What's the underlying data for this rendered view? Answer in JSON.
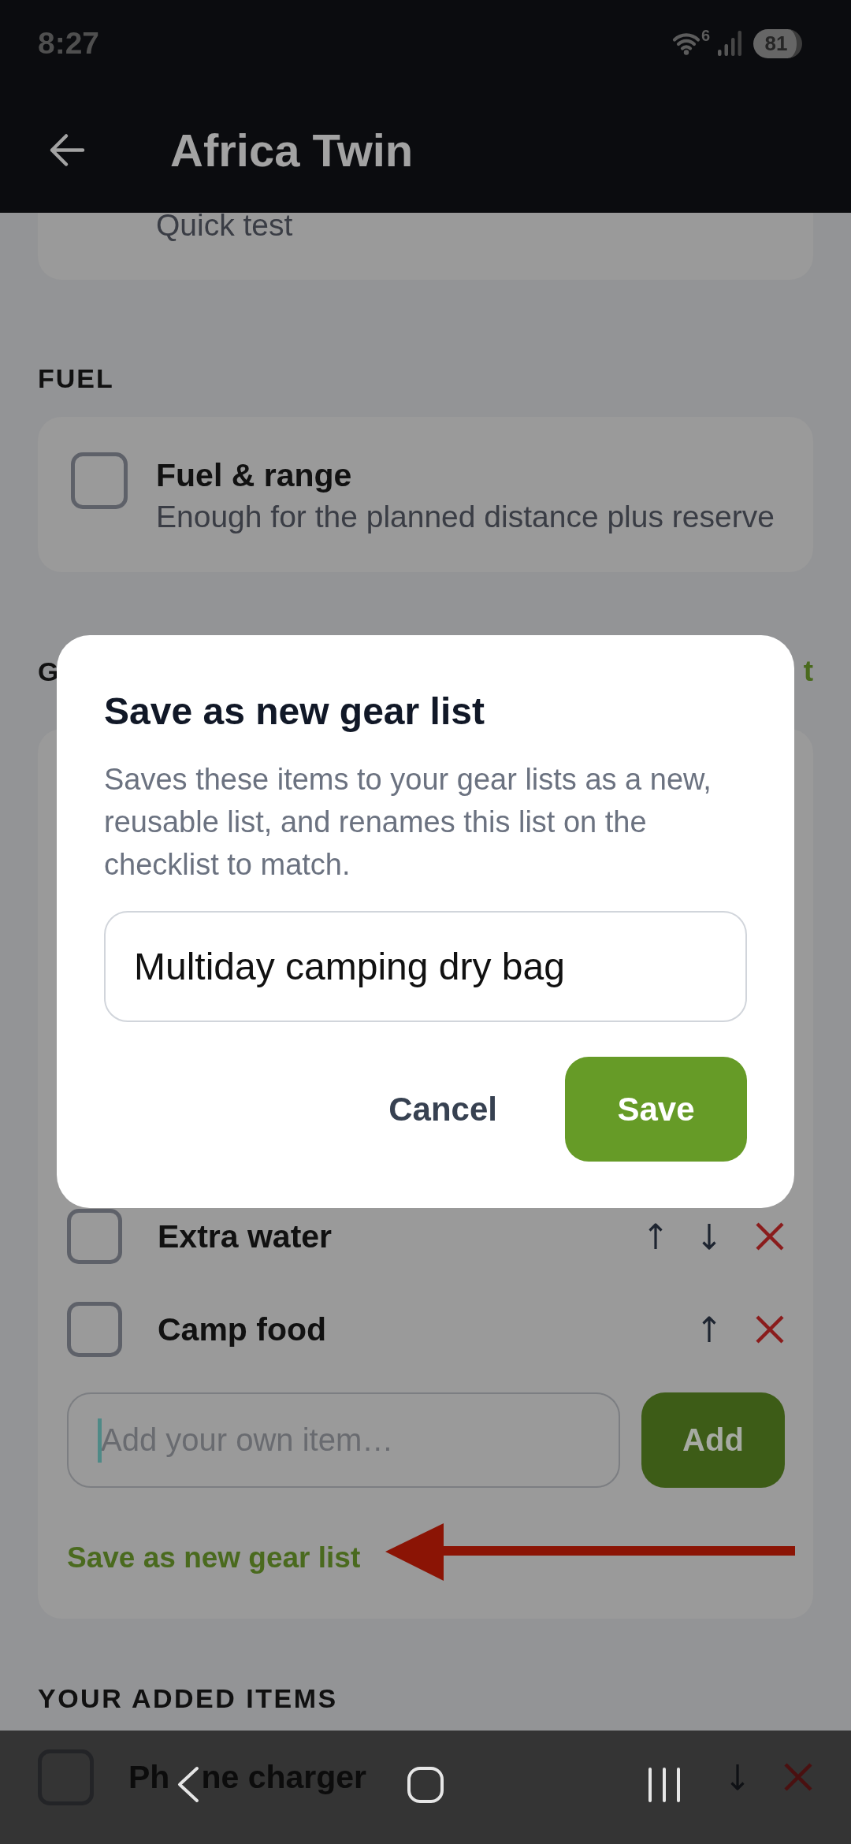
{
  "status_bar": {
    "time": "8:27",
    "wifi_label": "6",
    "battery": "81"
  },
  "header": {
    "title": "Africa Twin"
  },
  "top_card": {
    "subtitle": "Quick test"
  },
  "fuel_section": {
    "title": "FUEL",
    "items": [
      {
        "title": "Fuel & range",
        "subtitle": "Enough for the planned distance plus reserve",
        "checked": false
      }
    ]
  },
  "gear_section": {
    "title": "G",
    "action": "t",
    "items": [
      {
        "title": "Extra water",
        "checked": false,
        "can_move_up": true,
        "can_move_down": true
      },
      {
        "title": "Camp food",
        "checked": false,
        "can_move_up": true,
        "can_move_down": false
      }
    ],
    "add_field": {
      "placeholder": "Add your own item…",
      "focused": true
    },
    "add_button": "Add",
    "save_link": "Save as new gear list"
  },
  "added_section": {
    "title": "YOUR ADDED ITEMS",
    "items": [
      {
        "title_parts": [
          "Ph",
          "ne charger"
        ],
        "checked": false,
        "can_move_up": false,
        "can_move_down": true
      }
    ]
  },
  "annotations": [
    {
      "kind": "arrow"
    }
  ],
  "dialog": {
    "title": "Save as new gear list",
    "message": "Saves these items to your gear lists as a new, reusable list, and renames this list on the checklist to match.",
    "name_field": {
      "value": "Multiday camping dry bag"
    },
    "buttons": [
      {
        "label": "Cancel",
        "kind": "text"
      },
      {
        "label": "Save",
        "kind": "primary"
      }
    ]
  },
  "navigation_bar": [
    {
      "kind": "back"
    },
    {
      "kind": "home"
    },
    {
      "kind": "recents"
    }
  ]
}
